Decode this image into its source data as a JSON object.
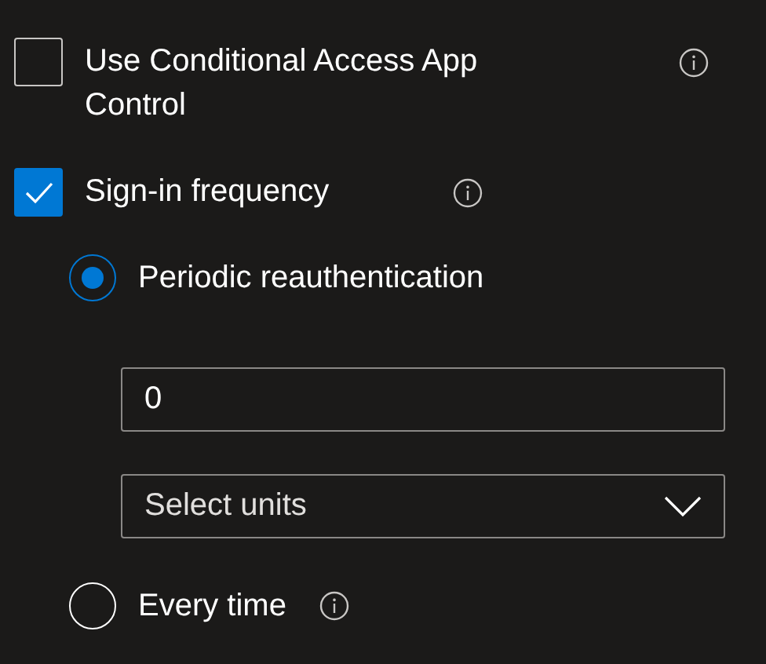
{
  "options": [
    {
      "kind": "checkbox",
      "label": "Use Conditional Access App Control",
      "checked": false,
      "info": true
    },
    {
      "kind": "checkbox",
      "label": "Sign-in frequency",
      "checked": true,
      "info": true
    }
  ],
  "frequency": {
    "choices": [
      {
        "label": "Periodic reauthentication",
        "selected": true,
        "info": false
      },
      {
        "label": "Every time",
        "selected": false,
        "info": true
      }
    ],
    "value_field": {
      "value": "0"
    },
    "units_dropdown": {
      "placeholder": "Select units"
    }
  }
}
